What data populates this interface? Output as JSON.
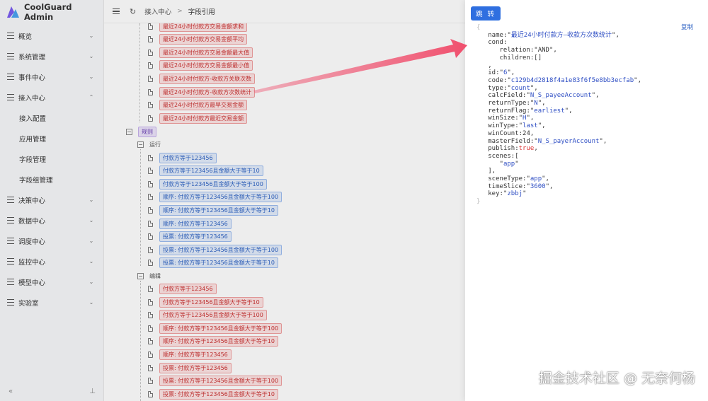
{
  "app": {
    "title": "CoolGuard Admin"
  },
  "sidebar": {
    "items": [
      {
        "label": "概览",
        "chevron": "down"
      },
      {
        "label": "系统管理",
        "chevron": "down"
      },
      {
        "label": "事件中心",
        "chevron": "down"
      },
      {
        "label": "接入中心",
        "chevron": "up",
        "expanded": true,
        "children": [
          "接入配置",
          "应用管理",
          "字段管理",
          "字段组管理"
        ]
      },
      {
        "label": "决策中心",
        "chevron": "down"
      },
      {
        "label": "数据中心",
        "chevron": "down"
      },
      {
        "label": "调度中心",
        "chevron": "down"
      },
      {
        "label": "监控中心",
        "chevron": "down"
      },
      {
        "label": "模型中心",
        "chevron": "down"
      },
      {
        "label": "实验室",
        "chevron": "down"
      }
    ],
    "footer": {
      "collapse": "«",
      "pin": "⊥"
    }
  },
  "header": {
    "breadcrumb": [
      "接入中心",
      "字段引用"
    ],
    "separator": ">"
  },
  "tree": {
    "indicator_nodes": [
      "最近24小时付款方交易金额求和",
      "最近24小时付款方交易金额平均",
      "最近24小时付款方交易金额最大值",
      "最近24小时付款方交易金额最小值",
      "最近24小时付款方-收款方关联次数",
      "最近24小时付款方-收款方次数统计",
      "最近24小时付款方最早交易金额",
      "最近24小时付款方最近交易金额"
    ],
    "rule_group": {
      "label": "规则",
      "toggle": "−"
    },
    "running": {
      "label": "运行",
      "toggle": "−",
      "nodes": [
        "付款方等于123456",
        "付款方等于123456且金额大于等于10",
        "付款方等于123456且金额大于等于100",
        "顺序: 付款方等于123456且金额大于等于100",
        "顺序: 付款方等于123456且金额大于等于10",
        "顺序: 付款方等于123456",
        "投票: 付款方等于123456",
        "投票: 付款方等于123456且金额大于等于100",
        "投票: 付款方等于123456且金额大于等于10"
      ]
    },
    "editing": {
      "label": "编辑",
      "toggle": "−",
      "nodes": [
        "付款方等于123456",
        "付款方等于123456且金额大于等于10",
        "付款方等于123456且金额大于等于100",
        "顺序: 付款方等于123456且金额大于等于100",
        "顺序: 付款方等于123456且金额大于等于10",
        "顺序: 付款方等于123456",
        "投票: 付款方等于123456",
        "投票: 付款方等于123456且金额大于等于100",
        "投票: 付款方等于123456且金额大于等于10"
      ]
    }
  },
  "panel": {
    "jump_label": "跳 转",
    "copy_label": "复制",
    "json": {
      "open": "{",
      "close": "}",
      "name": "最近24小时付款方—收款方次数统计",
      "cond_relation": "AND",
      "cond_children": "[]",
      "id": "6",
      "code": "c129b4d2818f4a1e83f6f5e8bb3ecfab",
      "type": "count",
      "calcField": "N_S_payeeAccount",
      "returnType": "N",
      "returnFlag": "earliest",
      "winSize": "H",
      "winType": "last",
      "winCount": "24",
      "masterField": "N_S_payerAccount",
      "publish": "true",
      "scene": "app",
      "sceneType": "app",
      "timeSlice": "3600",
      "key": "zbbj"
    }
  },
  "watermark": "掘金技术社区 @ 无奈何杨",
  "colors": {
    "primary": "#2f6fe0",
    "tag_red_bg": "#fde3e3",
    "tag_blue_bg": "#e2ecfb",
    "arrow": "#f0506e"
  }
}
